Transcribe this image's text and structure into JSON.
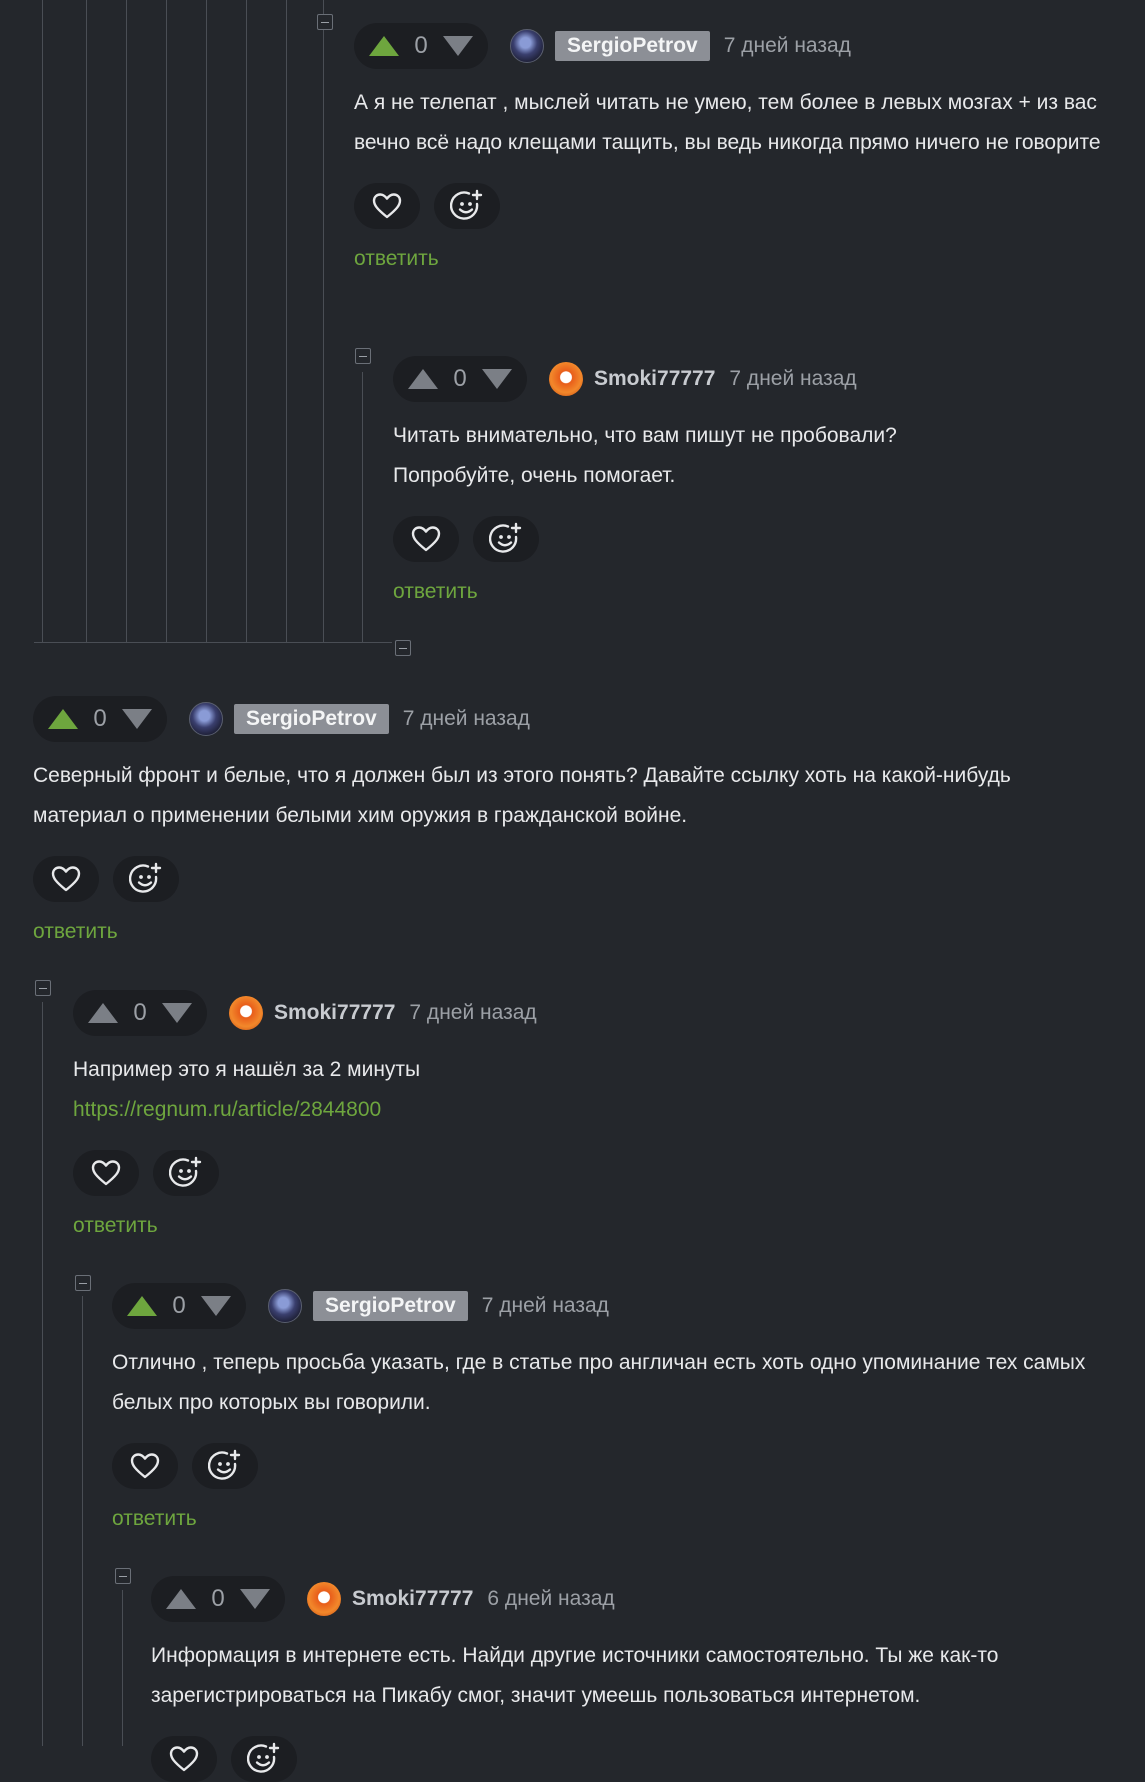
{
  "comments": [
    {
      "score": "0",
      "vote_state": "up",
      "username": "SergioPetrov",
      "user_is_author": true,
      "time": "7 дней назад",
      "text": "А я не телепат , мыслей читать не умею, тем более в левых мозгах + из вас вечно всё надо клещами тащить, вы ведь никогда прямо ничего не говорите",
      "reply_label": "ответить"
    },
    {
      "score": "0",
      "vote_state": "none",
      "username": "Smoki77777",
      "user_is_author": false,
      "time": "7 дней назад",
      "text": "Читать внимательно, что вам пишут не пробовали? Попробуйте, очень помогает.",
      "reply_label": "ответить"
    },
    {
      "score": "0",
      "vote_state": "up",
      "username": "SergioPetrov",
      "user_is_author": true,
      "time": "7 дней назад",
      "text": "Северный фронт и белые, что я должен был из этого понять? Давайте ссылку хоть на какой-нибудь материал о применении белыми хим оружия в гражданской войне.",
      "reply_label": "ответить"
    },
    {
      "score": "0",
      "vote_state": "none",
      "username": "Smoki77777",
      "user_is_author": false,
      "time": "7 дней назад",
      "text": "Например это я нашёл за 2 минуты",
      "link": "https://regnum.ru/article/2844800",
      "reply_label": "ответить"
    },
    {
      "score": "0",
      "vote_state": "up",
      "username": "SergioPetrov",
      "user_is_author": true,
      "time": "7 дней назад",
      "text": "Отлично , теперь просьба указать, где в статье про англичан есть хоть одно упоминание тех самых белых про которых вы говорили.",
      "reply_label": "ответить"
    },
    {
      "score": "0",
      "vote_state": "none",
      "username": "Smoki77777",
      "user_is_author": false,
      "time": "6 дней назад",
      "text": "Информация в интернете есть. Найди другие источники самостоятельно. Ты же как-то зарегистрироваться на Пикабу смог, значит умеешь пользоваться интернетом."
    }
  ],
  "icons": {
    "upvote": "arrow-up-icon",
    "downvote": "arrow-down-icon",
    "like": "heart-icon",
    "react": "smiley-plus-icon",
    "collapse": "minus-box-icon"
  },
  "colors": {
    "background": "#24272c",
    "pill": "#1c1e22",
    "accent_green": "#6ea63e",
    "author_badge": "#8c8f96"
  }
}
